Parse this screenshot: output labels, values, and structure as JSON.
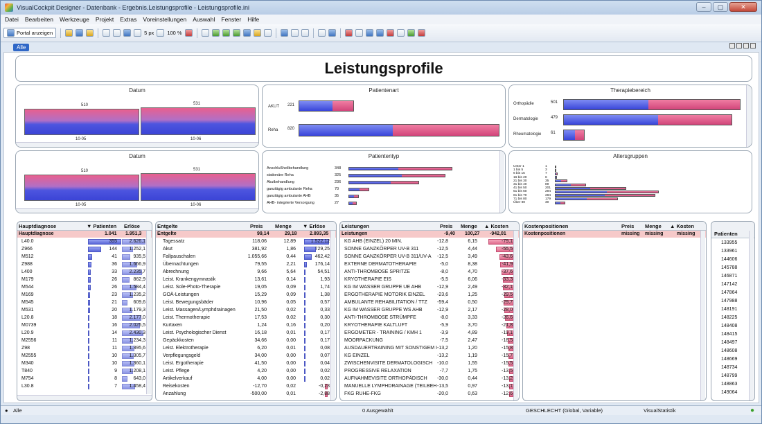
{
  "window": {
    "title": "VisualCockpit Designer - Datenbank - Ergebnis.Leistungsprofile - Leistungsprofile.ini",
    "min": "–",
    "max": "▢",
    "close": "✕"
  },
  "menu": [
    "Datei",
    "Bearbeiten",
    "Werkzeuge",
    "Projekt",
    "Extras",
    "Voreinstellungen",
    "Auswahl",
    "Fenster",
    "Hilfe"
  ],
  "toolbar": {
    "portal_label": "Portal anzeigen",
    "size_label": "5 px",
    "zoom_label": "100 %"
  },
  "tab": "Alle",
  "page_title": "Leistungsprofile",
  "charts": {
    "datum1": {
      "title": "Datum",
      "bars": [
        {
          "cat": "10-05",
          "value": 510
        },
        {
          "cat": "10-06",
          "value": 531
        }
      ]
    },
    "datum2": {
      "title": "Datum",
      "bars": [
        {
          "cat": "10-05",
          "value": 510
        },
        {
          "cat": "10-06",
          "value": 531
        }
      ]
    },
    "patientenart": {
      "title": "Patientenart",
      "rows": [
        {
          "label": "AKUT",
          "value": 221,
          "blue": 0.62
        },
        {
          "label": "Reha",
          "value": 820,
          "blue": 0.47
        }
      ]
    },
    "therapiebereich": {
      "title": "Therapiebereich",
      "rows": [
        {
          "label": "Orthopädie",
          "value": 501,
          "blue": 0.48
        },
        {
          "label": "Dermatologie",
          "value": 479,
          "blue": 0.56
        },
        {
          "label": "Rheumatologie",
          "value": 61,
          "blue": 0.55
        }
      ]
    },
    "patiententyp": {
      "title": "Patiententyp",
      "rows": [
        {
          "label": "Anschlußheilbehandlung",
          "value": 348,
          "blue": 0.48
        },
        {
          "label": "stationäre Reha",
          "value": 325,
          "blue": 0.55
        },
        {
          "label": "Akutbehandlung",
          "value": 236,
          "blue": 0.6
        },
        {
          "label": "ganztägig ambulante Reha",
          "value": 70,
          "blue": 0.55
        },
        {
          "label": "ganztägig ambulante AHB",
          "value": 35,
          "blue": 0.5
        },
        {
          "label": "AHB- integrierte Versorgung",
          "value": 27,
          "blue": 0.5
        }
      ]
    },
    "altersgruppen": {
      "title": "Altersgruppen",
      "rows": [
        {
          "label": "Unter 1",
          "value": 1
        },
        {
          "label": "1 bis 5",
          "value": 3
        },
        {
          "label": "6 bis 15",
          "value": 7
        },
        {
          "label": "16 bis 20",
          "value": 6
        },
        {
          "label": "21 bis 30",
          "value": 35
        },
        {
          "label": "31 bis 40",
          "value": 89
        },
        {
          "label": "41 bis 50",
          "value": 201
        },
        {
          "label": "51 bis 60",
          "value": 294
        },
        {
          "label": "61 bis 70",
          "value": 284
        },
        {
          "label": "71 bis 80",
          "value": 179
        },
        {
          "label": "Über 80",
          "value": 30
        }
      ]
    }
  },
  "diag": {
    "headers": [
      "Hauptdiagnose",
      "▼ Patienten",
      "Erlöse"
    ],
    "sum": [
      "1.041",
      "1.951,3"
    ],
    "rows": [
      [
        "L40.0",
        "355",
        "2.626,1"
      ],
      [
        "Z966",
        "144",
        "1.252,1"
      ],
      [
        "M512",
        "41",
        "935,5"
      ],
      [
        "Z988",
        "36",
        "1.666,9"
      ],
      [
        "L400",
        "33",
        "2.235,7"
      ],
      [
        "M179",
        "26",
        "862,9"
      ],
      [
        "M544",
        "26",
        "1.584,4"
      ],
      [
        "M169",
        "23",
        "1.235,2"
      ],
      [
        "M545",
        "21",
        "609,6"
      ],
      [
        "M531",
        "20",
        "1.179,3"
      ],
      [
        "L20.8",
        "18",
        "2.177,0"
      ],
      [
        "M0739",
        "16",
        "2.025,5"
      ],
      [
        "L20.9",
        "14",
        "2.430,3"
      ],
      [
        "M2556",
        "11",
        "1.234,3"
      ],
      [
        "Z98",
        "11",
        "1.395,6"
      ],
      [
        "M2555",
        "10",
        "1.305,7"
      ],
      [
        "M340",
        "10",
        "1.360,1"
      ],
      [
        "T840",
        "9",
        "1.208,1"
      ],
      [
        "M754",
        "8",
        "643,0"
      ],
      [
        "L30.8",
        "7",
        "1.458,4"
      ]
    ]
  },
  "entgelte": {
    "headers": [
      "Entgelte",
      "Preis",
      "Menge",
      "▼ Erlöse"
    ],
    "sum": [
      "99,14",
      "29,18",
      "2.893,35"
    ],
    "rows": [
      [
        "Tagessatz",
        "118,06",
        "12,89",
        "1.522,12"
      ],
      [
        "Akut",
        "381,92",
        "1,86",
        "729,25"
      ],
      [
        "Fallpauschalen",
        "1.055,66",
        "0,44",
        "462,42"
      ],
      [
        "Übernachtungen",
        "79,55",
        "2,21",
        "176,14"
      ],
      [
        "Abrechnung",
        "9,66",
        "5,64",
        "54,51"
      ],
      [
        "Leist. Krankengymnastik",
        "13,61",
        "0,14",
        "1,93"
      ],
      [
        "Leist. Sole-Photo-Therapie",
        "19,05",
        "0,09",
        "1,74"
      ],
      [
        "GOÄ-Leistungen",
        "15,29",
        "0,09",
        "1,38"
      ],
      [
        "Leist. Bewegungsbäder",
        "10,96",
        "0,05",
        "0,57"
      ],
      [
        "Leist. Massagen/Lymphdrainagen",
        "21,50",
        "0,02",
        "0,33"
      ],
      [
        "Leist. Thermotherapie",
        "17,53",
        "0,02",
        "0,30"
      ],
      [
        "Kurtaxen",
        "1,24",
        "0,16",
        "0,20"
      ],
      [
        "Leist. Psychologischer Dienst",
        "16,18",
        "0,01",
        "0,17"
      ],
      [
        "Gepäckkosten",
        "34,66",
        "0,00",
        "0,17"
      ],
      [
        "Leist. Elektrotherapie",
        "6,20",
        "0,01",
        "0,08"
      ],
      [
        "Verpflegungsgeld",
        "34,00",
        "0,00",
        "0,07"
      ],
      [
        "Leist. Ergotherapie",
        "41,50",
        "0,00",
        "0,04"
      ],
      [
        "Leist. Pflege",
        "4,20",
        "0,00",
        "0,02"
      ],
      [
        "Artikelverkauf",
        "4,00",
        "0,00",
        "0,02"
      ],
      [
        "Reisekosten",
        "-12,70",
        "0,02",
        "-0,23"
      ],
      [
        "Anzahlung",
        "-500,00",
        "0,01",
        "-2,88"
      ]
    ]
  },
  "leistungen": {
    "headers": [
      "Leistungen",
      "Preis",
      "Menge",
      "▲ Kosten"
    ],
    "sum": [
      "-9,40",
      "100,27",
      "-942,01"
    ],
    "rows": [
      [
        "KG AHB (EINZEL) 20 MIN.",
        "-12,8",
        "6,15",
        "-79,1"
      ],
      [
        "SONNE GANZKÖRPER UV-B 311",
        "-12,5",
        "4,44",
        "-55,5"
      ],
      [
        "SONNE GANZKÖRPER UV-B 311/UV-A",
        "-12,5",
        "3,49",
        "-43,6"
      ],
      [
        "EXTERNE DERMATOTHERAPIE",
        "-5,0",
        "8,38",
        "-41,9"
      ],
      [
        "ANTI-THROMBOSE SPRITZE",
        "-8,0",
        "4,70",
        "-37,6"
      ],
      [
        "KRYOTHERAPIE EIS",
        "-5,5",
        "6,06",
        "-33,3"
      ],
      [
        "KG IM WASSER GRUPPE UE AHB",
        "-12,9",
        "2,49",
        "-32,1"
      ],
      [
        "ERGOTHERAPIE MOTORIK EINZEL",
        "-23,6",
        "1,25",
        "-29,5"
      ],
      [
        "AMBULANTE REHABILITATION / TTZ",
        "-59,4",
        "0,50",
        "-29,7"
      ],
      [
        "KG IM WASSER GRUPPE WS AHB",
        "-12,9",
        "2,17",
        "-28,0"
      ],
      [
        "ANTI-THROMBOSE STRÜMPFE",
        "-8,0",
        "3,33",
        "-26,6"
      ],
      [
        "KRYOTHERAPIE KALTLUFT",
        "-5,9",
        "3,70",
        "-21,8"
      ],
      [
        "ERGOMETER - TRAINING / KMH 1",
        "-3,9",
        "4,89",
        "-19,1"
      ],
      [
        "MOORPACKUNG",
        "-7,5",
        "2,47",
        "-18,5"
      ],
      [
        "AUSDAUERTRAINING MIT SONSTIGEM I",
        "-13,2",
        "1,20",
        "-15,8"
      ],
      [
        "KG EINZEL",
        "-13,2",
        "1,19",
        "-15,7"
      ],
      [
        "ZWISCHENVISITE DERMATOLOGISCH",
        "-10,0",
        "1,55",
        "-15,5"
      ],
      [
        "PROGRESSIVE RELAXATION",
        "-7,7",
        "1,75",
        "-13,5"
      ],
      [
        "AUFNAHMEVISITE ORTHOPÄDISCH",
        "-30,0",
        "0,44",
        "-13,2"
      ],
      [
        "MANUELLE LYMPHDRAINAGE (TEILBEH",
        "-13,5",
        "0,97",
        "-13,1"
      ],
      [
        "FKG RUHE-FKG",
        "-20,0",
        "0,63",
        "-12,6"
      ]
    ]
  },
  "kosten": {
    "headers": [
      "Kostenpositionen",
      "Preis",
      "Menge",
      "▲ Kosten"
    ],
    "sum": [
      "missing",
      "missing",
      "missing"
    ]
  },
  "patienten": {
    "header": "Patienten",
    "rows": [
      "133955",
      "133961",
      "144606",
      "145788",
      "146871",
      "147142",
      "147864",
      "147988",
      "148191",
      "148225",
      "148408",
      "148415",
      "148497",
      "148608",
      "148669",
      "148734",
      "148799",
      "148863",
      "149064"
    ]
  },
  "status": {
    "left": "Alle",
    "center": "0 Ausgewählt",
    "filter": "GESCHLECHT (Global, Variable)",
    "stat": "VisualStatistik"
  }
}
